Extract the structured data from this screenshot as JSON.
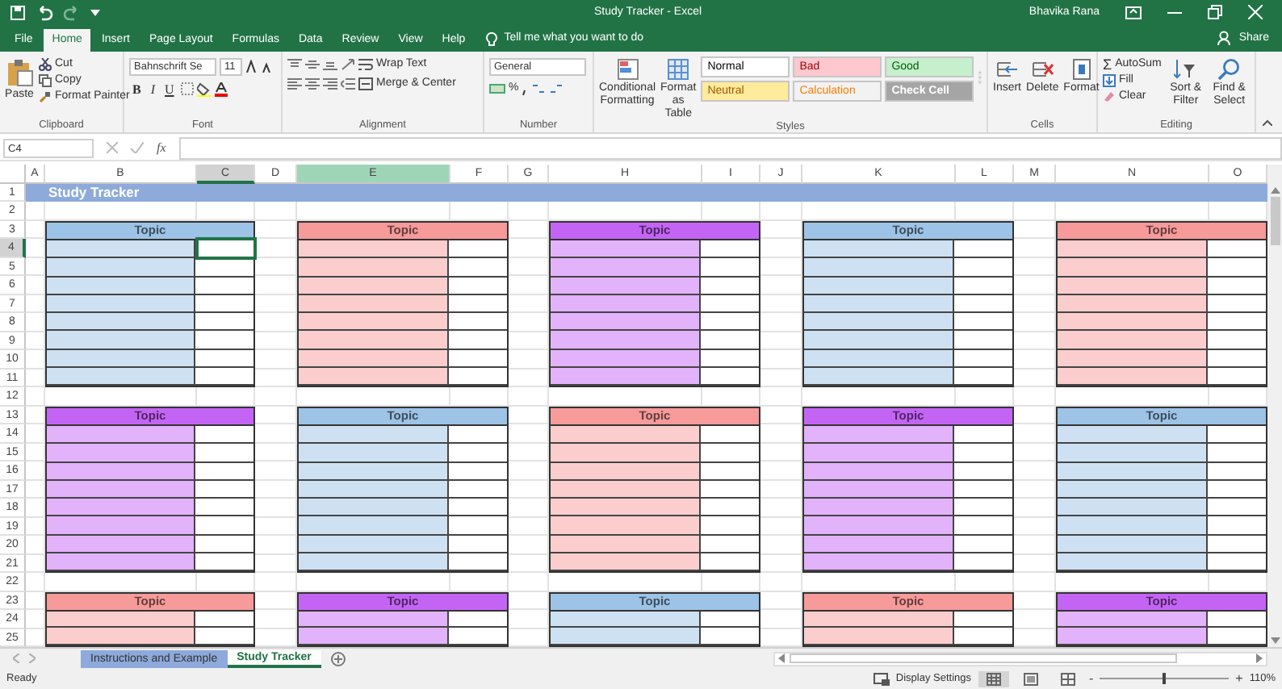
{
  "title_bar": {
    "title": "Study Tracker  -  Excel",
    "user": "Bhavika Rana"
  },
  "menu_tabs": [
    {
      "label": "File",
      "selected": false
    },
    {
      "label": "Home",
      "selected": true
    },
    {
      "label": "Insert",
      "selected": false
    },
    {
      "label": "Page Layout",
      "selected": false
    },
    {
      "label": "Formulas",
      "selected": false
    },
    {
      "label": "Data",
      "selected": false
    },
    {
      "label": "Review",
      "selected": false
    },
    {
      "label": "View",
      "selected": false
    },
    {
      "label": "Help",
      "selected": false
    }
  ],
  "tell_me": "Tell me what you want to do",
  "share": "Share",
  "ribbon": {
    "clipboard": {
      "label": "Clipboard",
      "paste": "Paste",
      "cut": "Cut",
      "copy": "Copy",
      "format_painter": "Format Painter"
    },
    "font": {
      "label": "Font",
      "font_name": "Bahnschrift Se",
      "font_size": "11",
      "bold": "B",
      "italic": "I",
      "underline": "U"
    },
    "alignment": {
      "label": "Alignment",
      "wrap_text": "Wrap Text",
      "merge_center": "Merge & Center"
    },
    "number": {
      "label": "Number",
      "format": "General",
      "percent": "%"
    },
    "styles": {
      "label": "Styles",
      "conditional_formatting": "Conditional Formatting",
      "format_as_table": "Format as Table",
      "cell_styles": [
        {
          "label": "Normal",
          "kind": "normal"
        },
        {
          "label": "Bad",
          "kind": "bad"
        },
        {
          "label": "Good",
          "kind": "good"
        },
        {
          "label": "Neutral",
          "kind": "neutral"
        },
        {
          "label": "Calculation",
          "kind": "calculation"
        },
        {
          "label": "Check Cell",
          "kind": "check"
        }
      ]
    },
    "cells": {
      "label": "Cells",
      "insert": "Insert",
      "delete": "Delete",
      "format": "Format"
    },
    "editing": {
      "label": "Editing",
      "sigma": "Σ",
      "autosum": "AutoSum",
      "fill": "Fill",
      "clear": "Clear",
      "sort_filter": "Sort & Filter",
      "find_select": "Find & Select"
    }
  },
  "formula_bar": {
    "name_box": "C4",
    "fx": "fx"
  },
  "columns": [
    {
      "label": "A",
      "selected": false,
      "highlighted": false
    },
    {
      "label": "B",
      "selected": false,
      "highlighted": false
    },
    {
      "label": "C",
      "selected": true,
      "highlighted": false
    },
    {
      "label": "D",
      "selected": false,
      "highlighted": false
    },
    {
      "label": "E",
      "selected": false,
      "highlighted": true
    },
    {
      "label": "F",
      "selected": false,
      "highlighted": false
    },
    {
      "label": "G",
      "selected": false,
      "highlighted": false
    },
    {
      "label": "H",
      "selected": false,
      "highlighted": false
    },
    {
      "label": "I",
      "selected": false,
      "highlighted": false
    },
    {
      "label": "J",
      "selected": false,
      "highlighted": false
    },
    {
      "label": "K",
      "selected": false,
      "highlighted": false
    },
    {
      "label": "L",
      "selected": false,
      "highlighted": false
    },
    {
      "label": "M",
      "selected": false,
      "highlighted": false
    },
    {
      "label": "N",
      "selected": false,
      "highlighted": false
    },
    {
      "label": "O",
      "selected": false,
      "highlighted": false
    }
  ],
  "rows": [
    {
      "label": "1",
      "selected": false
    },
    {
      "label": "2",
      "selected": false
    },
    {
      "label": "3",
      "selected": false
    },
    {
      "label": "4",
      "selected": true
    },
    {
      "label": "5",
      "selected": false
    },
    {
      "label": "6",
      "selected": false
    },
    {
      "label": "7",
      "selected": false
    },
    {
      "label": "8",
      "selected": false
    },
    {
      "label": "9",
      "selected": false
    },
    {
      "label": "10",
      "selected": false
    },
    {
      "label": "11",
      "selected": false
    },
    {
      "label": "12",
      "selected": false
    },
    {
      "label": "13",
      "selected": false
    },
    {
      "label": "14",
      "selected": false
    },
    {
      "label": "15",
      "selected": false
    },
    {
      "label": "16",
      "selected": false
    },
    {
      "label": "17",
      "selected": false
    },
    {
      "label": "18",
      "selected": false
    },
    {
      "label": "19",
      "selected": false
    },
    {
      "label": "20",
      "selected": false
    },
    {
      "label": "21",
      "selected": false
    },
    {
      "label": "22",
      "selected": false
    },
    {
      "label": "23",
      "selected": false
    },
    {
      "label": "24",
      "selected": false
    },
    {
      "label": "25",
      "selected": false
    }
  ],
  "sheet_title": "Study Tracker",
  "bands": [
    {
      "cards": [
        {
          "header": "Topic",
          "color": "#9dc3e6"
        },
        {
          "header": "Topic",
          "color": "#f79a9a"
        },
        {
          "header": "Topic",
          "color": "#c464f5"
        },
        {
          "header": "Topic",
          "color": "#9dc3e6"
        },
        {
          "header": "Topic",
          "color": "#f79a9a"
        }
      ]
    },
    {
      "cards": [
        {
          "header": "Topic",
          "color": "#c464f5"
        },
        {
          "header": "Topic",
          "color": "#9dc3e6"
        },
        {
          "header": "Topic",
          "color": "#f79a9a"
        },
        {
          "header": "Topic",
          "color": "#c464f5"
        },
        {
          "header": "Topic",
          "color": "#9dc3e6"
        }
      ]
    },
    {
      "cards": [
        {
          "header": "Topic",
          "color": "#f79a9a"
        },
        {
          "header": "Topic",
          "color": "#c464f5"
        },
        {
          "header": "Topic",
          "color": "#9dc3e6"
        },
        {
          "header": "Topic",
          "color": "#f79a9a"
        },
        {
          "header": "Topic",
          "color": "#c464f5"
        }
      ]
    }
  ],
  "sheet_tabs": [
    {
      "label": "Instructions and Example",
      "selected": false,
      "color": "#8ea9db"
    },
    {
      "label": "Study Tracker",
      "selected": true
    }
  ],
  "status_bar": {
    "status": "Ready",
    "display_settings": "Display Settings",
    "views": [
      {
        "kind": "normal",
        "selected": true
      },
      {
        "kind": "page-layout",
        "selected": false
      },
      {
        "kind": "page-break",
        "selected": false
      }
    ],
    "zoom_out": "-",
    "zoom_in": "+",
    "zoom": {
      "level": 0.5
    },
    "zoom_label": "110%"
  }
}
